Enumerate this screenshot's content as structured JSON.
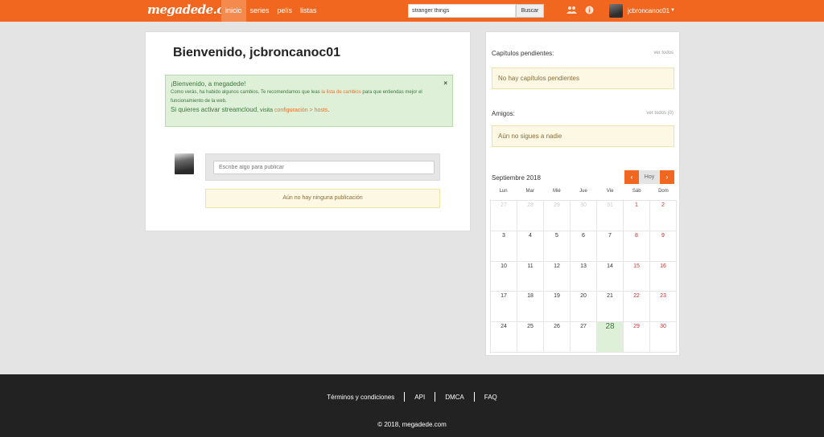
{
  "header": {
    "logo": "megadede.com",
    "nav": [
      "inicio",
      "series",
      "pelis",
      "listas"
    ],
    "search_value": "stranger things",
    "search_button": "Buscar",
    "username": "jcbroncanoc01",
    "icons": [
      "users-icon",
      "info-icon",
      "caret-down-icon"
    ]
  },
  "main": {
    "title": "Bienvenido, jcbroncanoc01",
    "alert": {
      "title": "¡Bienvenido, a megadede!",
      "body_1": "Como verás, ha habido algunos cambios. Te recomendamos que leas ",
      "link_1": "la lista de cambios",
      "body_2": " para que entiendas mejor el funcionamiento de la web.",
      "strong": "Si quieres activar streamcloud",
      "strong_2": ", visita ",
      "link_2": "configuración > hosts",
      "strong_3": ".",
      "close": "×"
    },
    "post_placeholder": "Escribe algo para publicar",
    "no_posts": "Aún no hay ninguna publicación"
  },
  "sidebar": {
    "pending_title": "Capítulos pendientes:",
    "pending_link": "ver todos",
    "pending_empty": "No hay capítulos pendientes",
    "friends_title": "Amigos:",
    "friends_link": "ver todos (0)",
    "friends_empty": "Aún no sigues a nadie",
    "calendar": {
      "month": "Septiembre 2018",
      "prev": "‹",
      "today": "Hoy",
      "next": "›",
      "weekdays": [
        "Lun",
        "Mar",
        "Mié",
        "Jue",
        "Vie",
        "Sáb",
        "Dom"
      ],
      "weeks": [
        [
          "27",
          "28",
          "29",
          "30",
          "31",
          "1",
          "2"
        ],
        [
          "3",
          "4",
          "5",
          "6",
          "7",
          "8",
          "9"
        ],
        [
          "10",
          "11",
          "12",
          "13",
          "14",
          "15",
          "16"
        ],
        [
          "17",
          "18",
          "19",
          "20",
          "21",
          "22",
          "23"
        ],
        [
          "24",
          "25",
          "26",
          "27",
          "28",
          "29",
          "30"
        ]
      ]
    }
  },
  "footer": {
    "links": [
      "Términos y condiciones",
      "API",
      "DMCA",
      "FAQ"
    ],
    "copyright": "© 2018, megadede.com"
  },
  "colors": {
    "brand": "#f2671f",
    "success_bg": "#dff0d8",
    "warning_bg": "#fcf8e3",
    "footer_bg": "#222222"
  }
}
